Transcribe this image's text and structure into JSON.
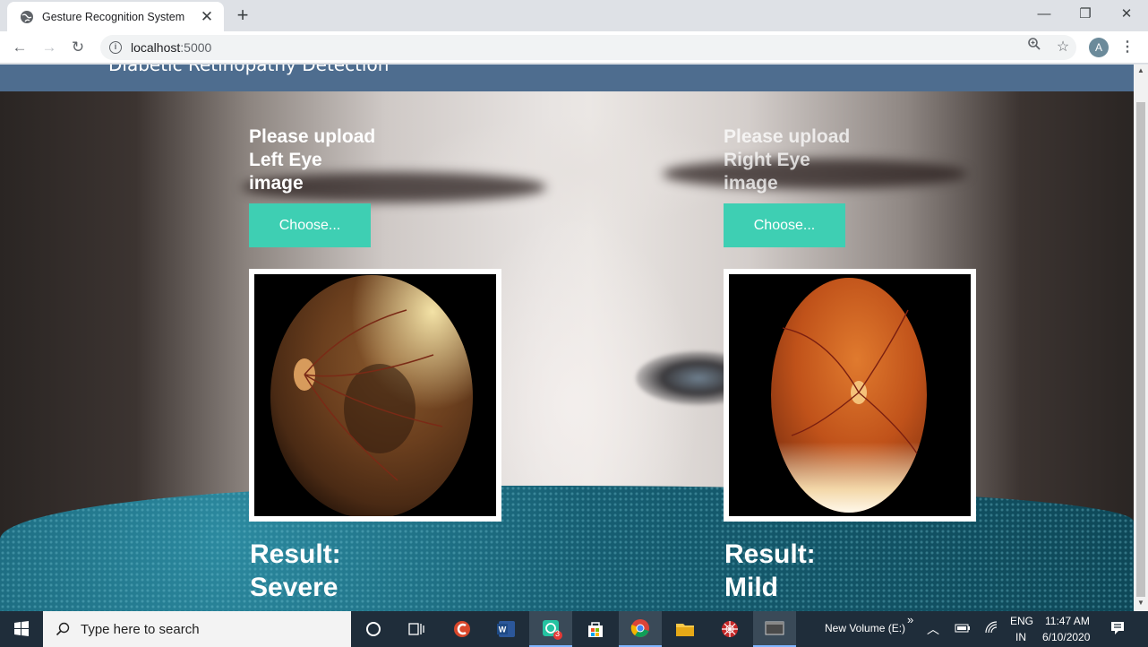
{
  "browser": {
    "tab_title": "Gesture Recognition System",
    "new_tab": "+",
    "url_host": "localhost",
    "url_port": ":5000",
    "profile_initial": "A"
  },
  "page": {
    "header_title": "Diabetic Retinopathy Detection",
    "left": {
      "prompt_line1": "Please upload",
      "prompt_line2": "Left Eye",
      "prompt_line3": "image",
      "button": "Choose...",
      "result_label": "Result:",
      "result_value": "Severe"
    },
    "right": {
      "prompt_line1": "Please upload",
      "prompt_line2": "Right Eye",
      "prompt_line3": "image",
      "button": "Choose...",
      "result_label": "Result:",
      "result_value": "Mild"
    }
  },
  "taskbar": {
    "search_placeholder": "Type here to search",
    "drive_label": "New Volume (E:)",
    "lang_top": "ENG",
    "lang_bottom": "IN",
    "time": "11:47 AM",
    "date": "6/10/2020",
    "badge_count": "3"
  },
  "colors": {
    "header": "#4e6d8f",
    "button": "#3ecfb3",
    "taskbar": "#1f2d3a"
  }
}
